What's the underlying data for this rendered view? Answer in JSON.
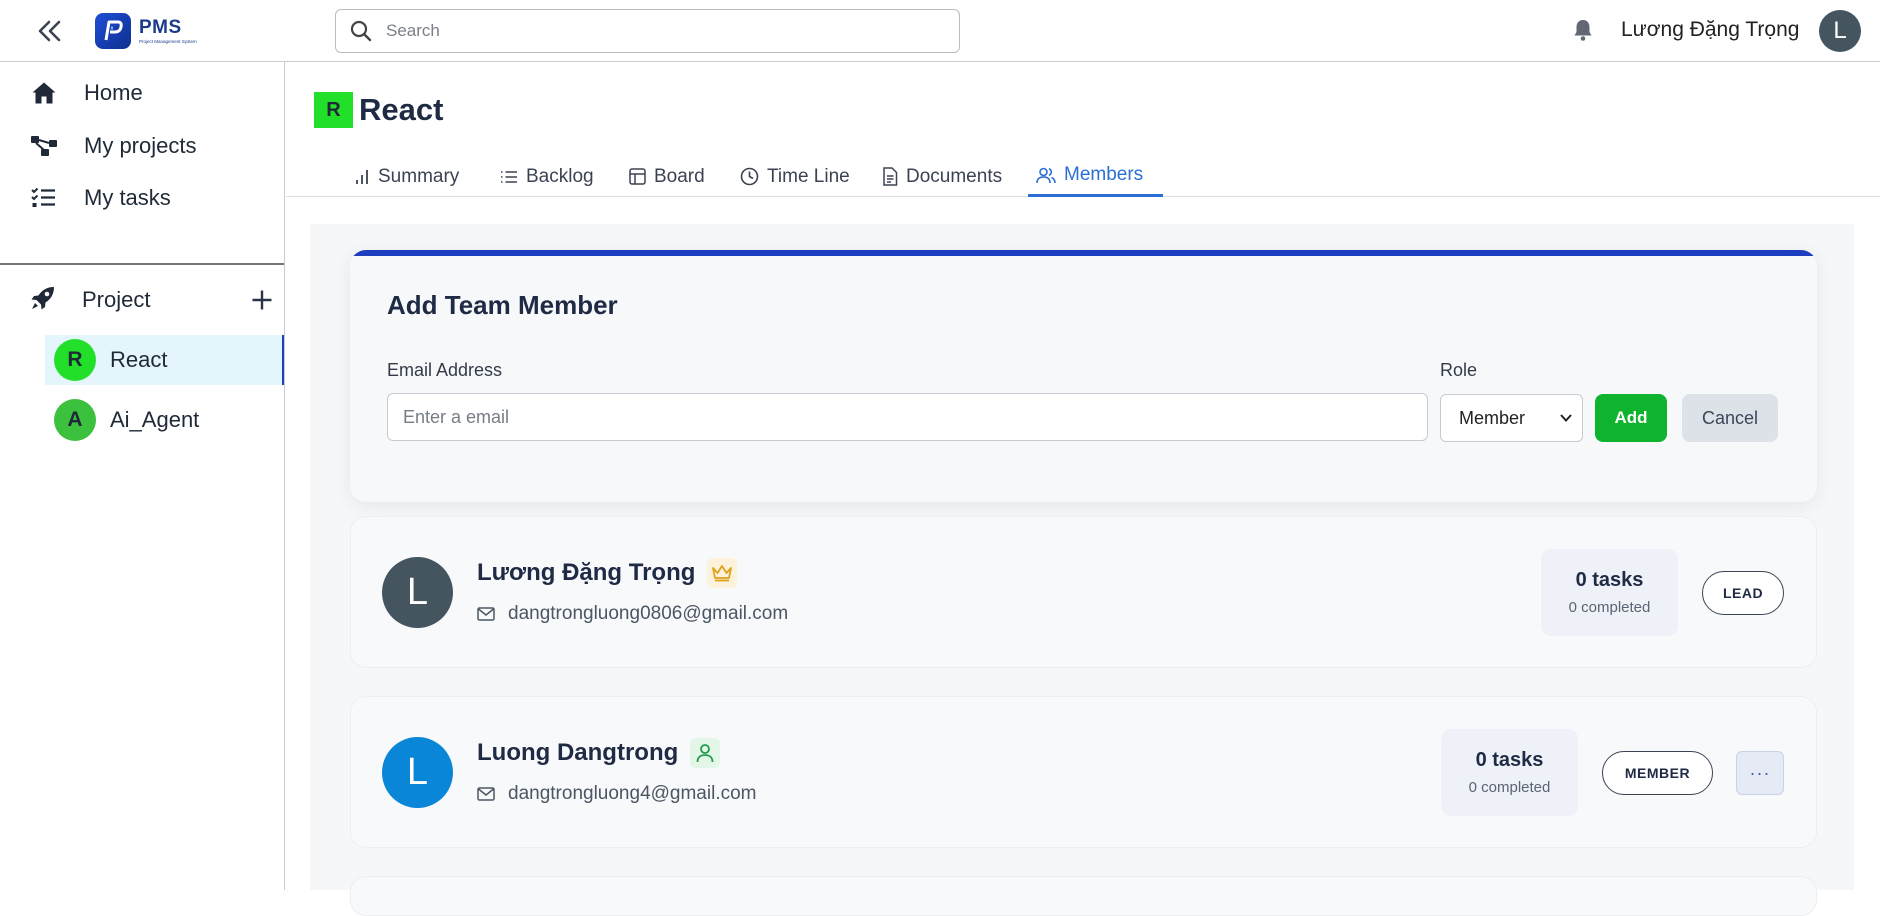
{
  "header": {
    "logo_name": "PMS",
    "logo_subtitle": "Project Management System",
    "search_placeholder": "Search",
    "user_name": "Lương Đặng Trọng",
    "user_initial": "L"
  },
  "sidebar": {
    "nav": [
      {
        "label": "Home",
        "icon": "home-icon"
      },
      {
        "label": "My projects",
        "icon": "projects-icon"
      },
      {
        "label": "My tasks",
        "icon": "tasks-icon"
      }
    ],
    "project_section_label": "Project",
    "projects": [
      {
        "initial": "R",
        "label": "React",
        "color": "#22e02a",
        "active": true
      },
      {
        "initial": "A",
        "label": "Ai_Agent",
        "color": "#3cc13f",
        "active": false
      }
    ]
  },
  "project": {
    "initial": "R",
    "title": "React",
    "color": "#22e02a"
  },
  "tabs": [
    {
      "label": "Summary",
      "icon": "bar-chart-icon"
    },
    {
      "label": "Backlog",
      "icon": "list-icon"
    },
    {
      "label": "Board",
      "icon": "board-icon"
    },
    {
      "label": "Time Line",
      "icon": "clock-icon"
    },
    {
      "label": "Documents",
      "icon": "document-icon"
    },
    {
      "label": "Members",
      "icon": "users-icon",
      "active": true
    }
  ],
  "add_member": {
    "title": "Add Team Member",
    "email_label": "Email Address",
    "email_placeholder": "Enter a email",
    "role_label": "Role",
    "role_selected": "Member",
    "add_label": "Add",
    "cancel_label": "Cancel"
  },
  "members": [
    {
      "initial": "L",
      "avatar_color": "#455560",
      "name": "Lương Đặng Trọng",
      "role_icon": "crown-icon",
      "email": "dangtrongluong0806@gmail.com",
      "tasks": "0 tasks",
      "completed": "0 completed",
      "role": "LEAD"
    },
    {
      "initial": "L",
      "avatar_color": "#0a86d8",
      "name": "Luong Dangtrong",
      "role_icon": "user-icon",
      "email": "dangtrongluong4@gmail.com",
      "tasks": "0 tasks",
      "completed": "0 completed",
      "role": "MEMBER",
      "more_label": "···"
    }
  ],
  "colors": {
    "accent": "#1d3fbf",
    "tab_active": "#2b6fd6",
    "add_button": "#0fb32e"
  }
}
